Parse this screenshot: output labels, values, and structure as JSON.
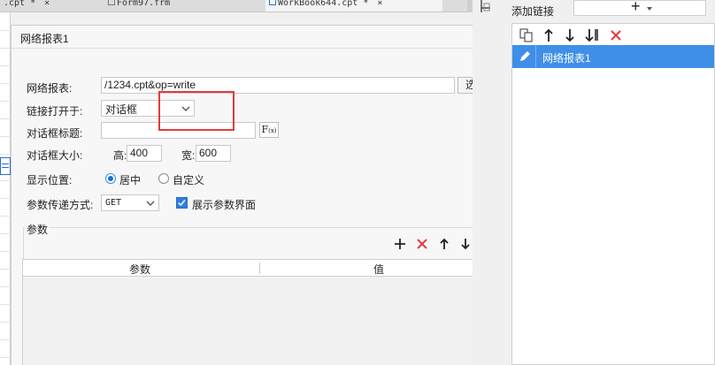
{
  "background_tabs": [
    {
      "label": ".cpt *",
      "close": "×"
    },
    {
      "label": "Form97.frm",
      "close": ""
    },
    {
      "label": "WorkBook644.cpt *",
      "close": "×"
    }
  ],
  "dialog": {
    "title": "网络报表1",
    "report_label": "网络报表:",
    "report_value": "/1234.cpt&op=write",
    "select_button": "选择",
    "open_in_label": "链接打开于:",
    "open_in_value": "对话框",
    "dialog_title_label": "对话框标题:",
    "dialog_title_value": "",
    "formula_button": "F",
    "formula_sub": "(x)",
    "size_label": "对话框大小:",
    "height_label": "高:",
    "height_value": "400",
    "width_label": "宽:",
    "width_value": "600",
    "position_label": "显示位置:",
    "position_options": [
      "居中",
      "自定义"
    ],
    "position_selected": "居中",
    "method_label": "参数传递方式:",
    "method_value": "GET",
    "show_params_label": "展示参数界面",
    "show_params_checked": true,
    "params_group_title": "参数",
    "params_columns": [
      "参数",
      "值"
    ],
    "params_rows": []
  },
  "links_panel": {
    "title": "添加链接",
    "add_button": "+",
    "items": [
      {
        "label": "网络报表1",
        "selected": true
      }
    ]
  },
  "colors": {
    "accent_blue": "#3f8fe8",
    "delete_red": "#e23b3b",
    "highlight_box": "#e23b3b"
  }
}
